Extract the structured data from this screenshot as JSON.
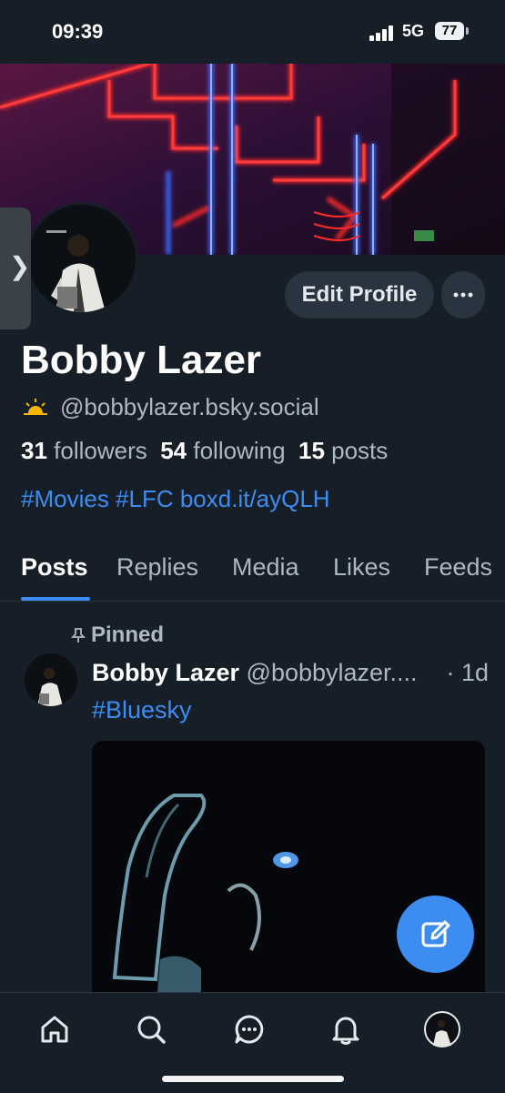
{
  "status_bar": {
    "time": "09:39",
    "network": "5G",
    "battery": "77"
  },
  "profile": {
    "name": "Bobby Lazer",
    "handle": "@bobbylazer.bsky.social",
    "followers_count": "31",
    "followers_label": "followers",
    "following_count": "54",
    "following_label": "following",
    "posts_count": "15",
    "posts_label": "posts",
    "bio": "#Movies #LFC boxd.it/ayQLH",
    "edit_label": "Edit Profile",
    "more_label": "···"
  },
  "tabs": [
    {
      "label": "Posts",
      "active": true
    },
    {
      "label": "Replies"
    },
    {
      "label": "Media"
    },
    {
      "label": "Likes"
    },
    {
      "label": "Feeds"
    }
  ],
  "pinned_post": {
    "pinned_label": "Pinned",
    "author": "Bobby Lazer",
    "handle": "@bobbylazer....",
    "time": "· 1d",
    "text": "#Bluesky"
  },
  "nav": {
    "items": [
      "home-icon",
      "search-icon",
      "chat-icon",
      "bell-icon",
      "profile-avatar"
    ]
  },
  "colors": {
    "accent": "#3d8cf0",
    "background": "#161e27",
    "button_bg": "#2a3440"
  }
}
